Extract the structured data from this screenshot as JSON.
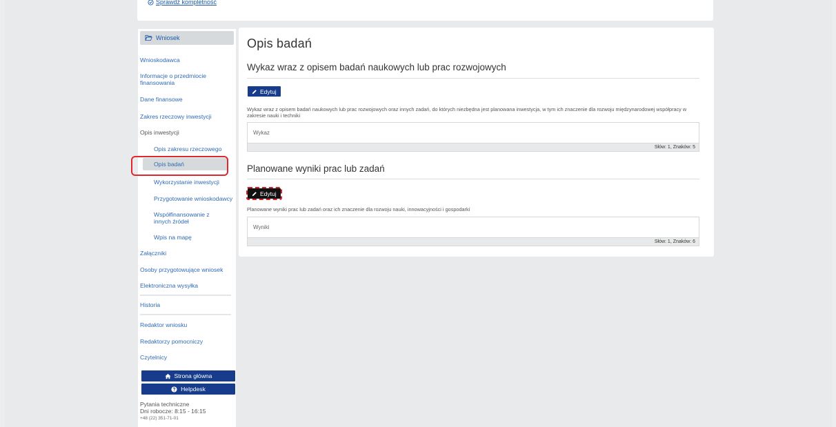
{
  "top": {
    "check_link": "Sprawdź kompletność"
  },
  "sidebar": {
    "header": "Wniosek",
    "items": [
      {
        "label": "Wnioskodawca"
      },
      {
        "label": "Informacje o przedmiocie finansowania"
      },
      {
        "label": "Dane finansowe"
      },
      {
        "label": "Zakres rzeczowy inwestycji"
      },
      {
        "label": "Opis inwestycji"
      },
      {
        "label": "Opis zakresu rzeczowego"
      },
      {
        "label": "Opis badań"
      },
      {
        "label": "Wykorzystanie inwestycji"
      },
      {
        "label": "Przygotowanie wnioskodawcy"
      },
      {
        "label": "Współfinansowanie z innych źródeł"
      },
      {
        "label": "Wpis na mapę"
      },
      {
        "label": "Załączniki"
      },
      {
        "label": "Osoby przygotowujące wniosek"
      },
      {
        "label": "Elektroniczna wysyłka"
      },
      {
        "label": "Historia"
      },
      {
        "label": "Redaktor wniosku"
      },
      {
        "label": "Redaktorzy pomocniczy"
      },
      {
        "label": "Czytelnicy"
      }
    ],
    "buttons": {
      "home": "Strona główna",
      "helpdesk": "Helpdesk"
    },
    "contact": {
      "line1": "Pytania techniczne",
      "line2": "Dni robocze: 8:15 - 16:15",
      "phone": "+48 (22) 351-71-01"
    }
  },
  "main": {
    "title": "Opis badań",
    "section1": {
      "title": "Wykaz wraz z opisem badań naukowych lub prac rozwojowych",
      "edit_label": "Edytuj",
      "description": "Wykaz wraz z opisem badań naukowych lub prac rozwojowych oraz innych zadań, do których niezbędna jest planowana inwestycja, w tym ich znaczenie dla rozwoju międzynarodowej współpracy w zakresie nauki i techniki",
      "value": "Wykaz",
      "counter": "Słów: 1, Znaków: 5"
    },
    "section2": {
      "title": "Planowane wyniki prac lub zadań",
      "edit_label": "Edytuj",
      "description": "Planowane wyniki prac lub zadań oraz ich znaczenie dla rozwoju nauki, innowacyjności i gospodarki",
      "value": "Wyniki",
      "counter": "Słów: 1, Znaków: 6"
    }
  },
  "colors": {
    "brand": "#173c8c",
    "link": "#2f6ab5",
    "highlight": "#e0282c"
  }
}
